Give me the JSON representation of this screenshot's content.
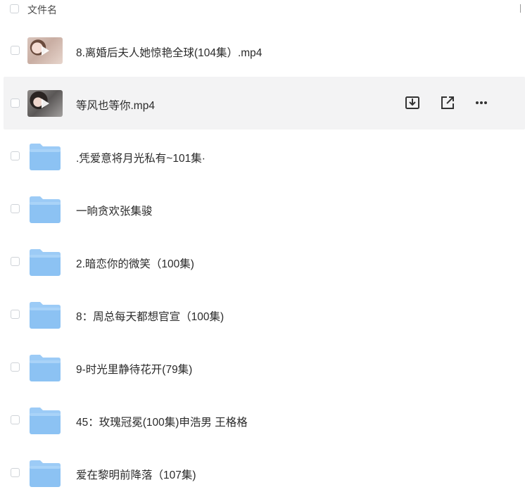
{
  "header": {
    "column_name": "文件名"
  },
  "files": [
    {
      "name": "8.离婚后夫人她惊艳全球(104集）.mp4",
      "type": "video",
      "thumb": "vid1",
      "selected": false
    },
    {
      "name": "等风也等你.mp4",
      "type": "video",
      "thumb": "vid2",
      "selected": true
    },
    {
      "name": ".凭爱意将月光私有~101集·",
      "type": "folder"
    },
    {
      "name": "一晌贪欢张集骏",
      "type": "folder"
    },
    {
      "name": "2.暗恋你的微笑（100集)",
      "type": "folder"
    },
    {
      "name": "8：周总每天都想官宣（100集)",
      "type": "folder"
    },
    {
      "name": "9-时光里静待花开(79集)",
      "type": "folder"
    },
    {
      "name": "45：玫瑰冠冕(100集)申浩男 王格格",
      "type": "folder"
    },
    {
      "name": "爱在黎明前降落（107集)",
      "type": "folder"
    }
  ],
  "row_actions": [
    "download-icon",
    "share-icon",
    "more-icon"
  ],
  "colors": {
    "folder_light": "#a9d3f8",
    "folder_main": "#8cc2f3",
    "selected_bg": "#f3f3f4"
  }
}
